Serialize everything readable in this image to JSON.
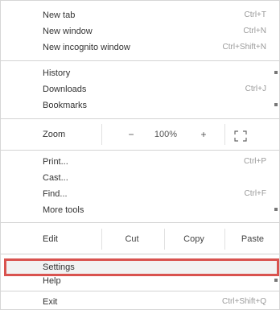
{
  "menu": {
    "group1": [
      {
        "label": "New tab",
        "shortcut": "Ctrl+T"
      },
      {
        "label": "New window",
        "shortcut": "Ctrl+N"
      },
      {
        "label": "New incognito window",
        "shortcut": "Ctrl+Shift+N"
      }
    ],
    "group2": [
      {
        "label": "History",
        "has_arrow": true
      },
      {
        "label": "Downloads",
        "shortcut": "Ctrl+J"
      },
      {
        "label": "Bookmarks",
        "has_arrow": true
      }
    ],
    "zoom": {
      "label": "Zoom",
      "minus": "−",
      "value": "100%",
      "plus": "+"
    },
    "group3": [
      {
        "label": "Print...",
        "shortcut": "Ctrl+P"
      },
      {
        "label": "Cast..."
      },
      {
        "label": "Find...",
        "shortcut": "Ctrl+F"
      },
      {
        "label": "More tools",
        "has_arrow": true
      }
    ],
    "edit": {
      "label": "Edit",
      "cut": "Cut",
      "copy": "Copy",
      "paste": "Paste"
    },
    "group4": [
      {
        "label": "Settings"
      },
      {
        "label": "Help",
        "has_arrow": true
      }
    ],
    "group5": [
      {
        "label": "Exit",
        "shortcut": "Ctrl+Shift+Q"
      }
    ]
  },
  "colors": {
    "highlight_border": "#d9534f",
    "shortcut_text": "#9a9a9a",
    "separator": "#d3d3d3"
  }
}
